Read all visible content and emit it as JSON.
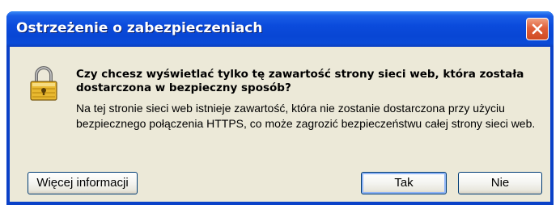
{
  "dialog": {
    "title": "Ostrzeżenie o zabezpieczeniach",
    "question": "Czy chcesz wyświetlać tylko tę zawartość strony sieci web, która została dostarczona w bezpieczny sposób?",
    "detail": "Na tej stronie sieci web istnieje zawartość, która nie zostanie dostarczona przy użyciu bezpiecznego połączenia HTTPS, co może zagrozić bezpieczeństwu całej strony sieci web.",
    "icon": "security-lock-icon",
    "buttons": {
      "more_info": "Więcej informacji",
      "yes": "Tak",
      "no": "Nie"
    }
  },
  "colors": {
    "titlebar": "#0846d4",
    "client_background": "#ece9d8",
    "close_button": "#e0603a",
    "lock": "#e8b830"
  }
}
